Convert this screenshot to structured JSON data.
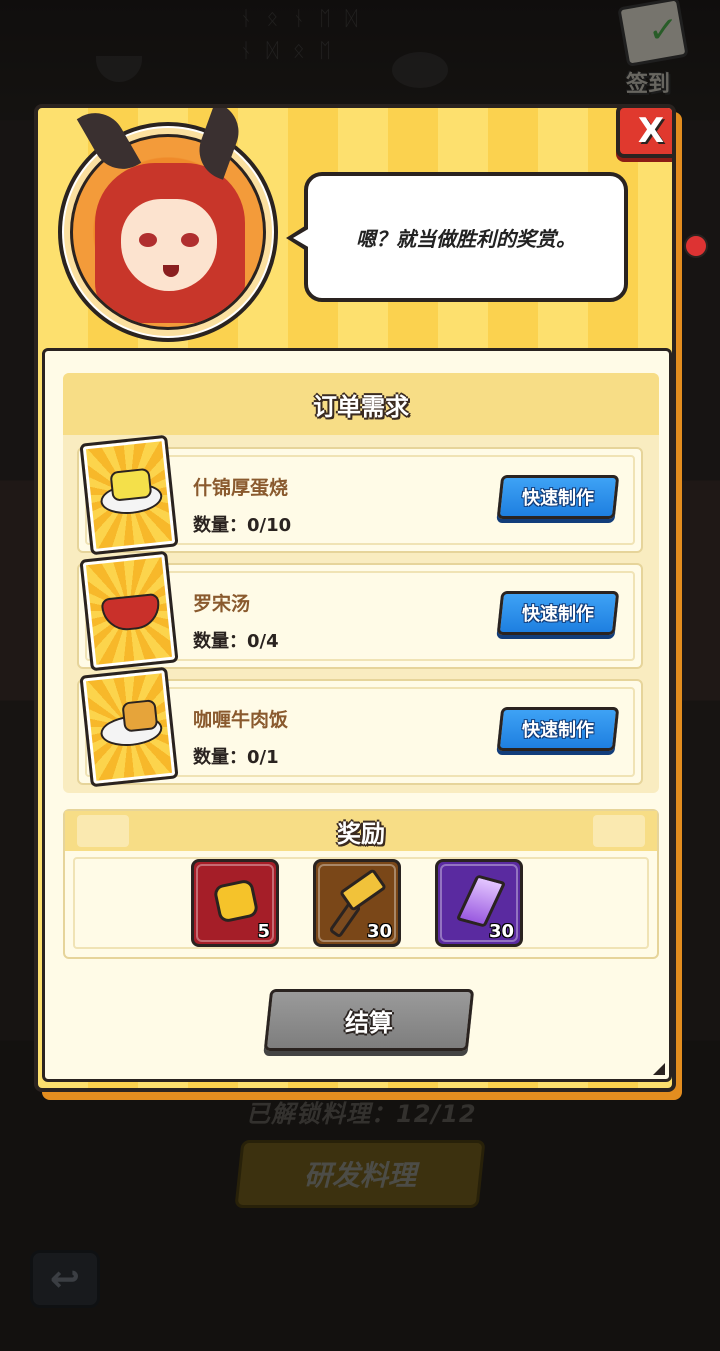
{
  "background": {
    "signin_label": "签到",
    "unlock_text": "已解锁料理：12/12",
    "develop_label": "研发料理",
    "back_icon": "↩"
  },
  "dialog": {
    "close_label": "X",
    "speech": "嗯？就当做胜利的奖赏。",
    "order_title": "订单需求",
    "orders": [
      {
        "name": "什锦厚蛋烧",
        "qty": "数量：0/10",
        "button": "快速制作",
        "icon": "tamagoyaki-icon",
        "color": "#f4e04a"
      },
      {
        "name": "罗宋汤",
        "qty": "数量：0/4",
        "button": "快速制作",
        "icon": "borscht-icon",
        "color": "#c9302a"
      },
      {
        "name": "咖喱牛肉饭",
        "qty": "数量：0/1",
        "button": "快速制作",
        "icon": "curry-beef-rice-icon",
        "color": "#e6a43a"
      }
    ],
    "reward_title": "奖励",
    "rewards": [
      {
        "icon": "gold-coin-icon",
        "count": "5"
      },
      {
        "icon": "hammer-icon",
        "count": "30"
      },
      {
        "icon": "purple-crystal-icon",
        "count": "30"
      }
    ],
    "settle_label": "结算"
  },
  "colors": {
    "accent_blue": "#1e7fe0",
    "close_red": "#e0392e",
    "panel_cream": "#fffbe7",
    "stripe_yellow": "#fde06e"
  }
}
